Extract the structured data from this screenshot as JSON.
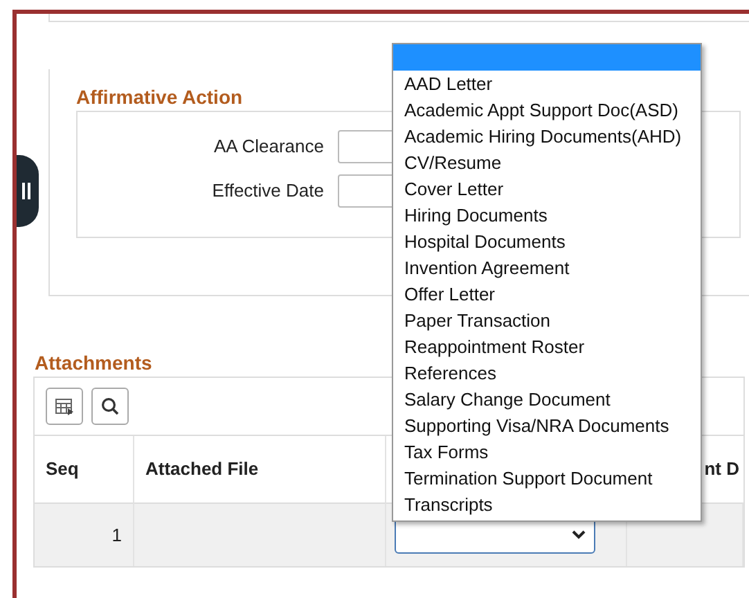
{
  "affirmative_action": {
    "title": "Affirmative Action",
    "fields": [
      {
        "label": "AA Clearance"
      },
      {
        "label": "Effective Date"
      }
    ]
  },
  "attachments": {
    "title": "Attachments",
    "columns": [
      "Seq",
      "Attached File",
      null,
      "nt D"
    ],
    "rows": [
      {
        "seq": "1"
      }
    ]
  },
  "dropdown": {
    "options": [
      {
        "selected": true
      },
      {
        "label": "AAD Letter",
        "selected": false
      },
      {
        "label": "Academic Appt Support Doc(ASD)",
        "selected": false
      },
      {
        "label": "Academic Hiring Documents(AHD)",
        "selected": false
      },
      {
        "label": "CV/Resume",
        "selected": false
      },
      {
        "label": "Cover Letter",
        "selected": false
      },
      {
        "label": "Hiring Documents",
        "selected": false
      },
      {
        "label": "Hospital Documents",
        "selected": false
      },
      {
        "label": "Invention Agreement",
        "selected": false
      },
      {
        "label": "Offer Letter",
        "selected": false
      },
      {
        "label": "Paper Transaction",
        "selected": false
      },
      {
        "label": "Reappointment Roster",
        "selected": false
      },
      {
        "label": "References",
        "selected": false
      },
      {
        "label": "Salary Change Document",
        "selected": false
      },
      {
        "label": "Supporting Visa/NRA Documents",
        "selected": false
      },
      {
        "label": "Tax Forms",
        "selected": false
      },
      {
        "label": "Termination Support Document",
        "selected": false
      },
      {
        "label": "Transcripts",
        "selected": false
      }
    ]
  }
}
